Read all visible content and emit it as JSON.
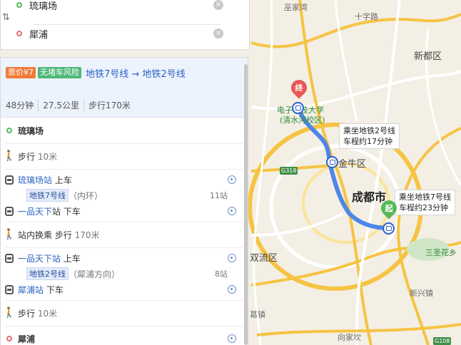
{
  "search": {
    "from": "琉璃场",
    "to": "犀浦",
    "clear_symbol": "×",
    "swap_symbol": "⇅"
  },
  "summary": {
    "fare_badge": "票价¥7",
    "safety_badge": "无堵车风险",
    "lines": "地铁7号线 → 地铁2号线",
    "duration": "48分钟",
    "distance": "27.5公里",
    "walk": "步行170米"
  },
  "steps": {
    "origin": "琉璃场",
    "walk1": "步行",
    "walk1_dist": "10米",
    "board1_station": "琉璃场站",
    "board1_action": "上车",
    "line1_name": "地铁7号线",
    "line1_dir": "（内环）",
    "line1_stations": "11站",
    "alight1_station": "一品天下",
    "alight1_action": "站 下车",
    "transfer": "站内换乘 步行",
    "transfer_dist": "170米",
    "board2_station": "一品天下站",
    "board2_action": "上车",
    "line2_name": "地铁2号线",
    "line2_dir": "（犀浦方向）",
    "line2_stations": "8站",
    "alight2_station": "犀浦站",
    "alight2_action": "下车",
    "walk2": "步行",
    "walk2_dist": "10米",
    "dest": "犀浦"
  },
  "map": {
    "tip_line2": "乘坐地铁2号线\n车程约17分钟",
    "tip_line2_a": "乘坐地铁2号线",
    "tip_line2_b": "车程约17分钟",
    "tip_line7_a": "乘坐地铁7号线",
    "tip_line7_b": "车程约23分钟",
    "start_pin": "起",
    "end_pin": "终",
    "labels": {
      "wuji": "巫家湾",
      "shizi": "十字路",
      "xindu": "新都区",
      "dianzi": "电子科技大学",
      "qingshui": "(清水河校区)",
      "jinniu": "金牛区",
      "chengdu": "成都市",
      "shuangliu": "双流区",
      "sansheng": "三圣花乡",
      "xinxing": "新兴镇",
      "xianghe": "向家坎",
      "huqiao": "葛镇"
    },
    "shields": {
      "g318": "G318",
      "g108": "G108"
    },
    "route_color": "#4d86e8",
    "accent_green": "#59b85a",
    "accent_red": "#e95757"
  }
}
